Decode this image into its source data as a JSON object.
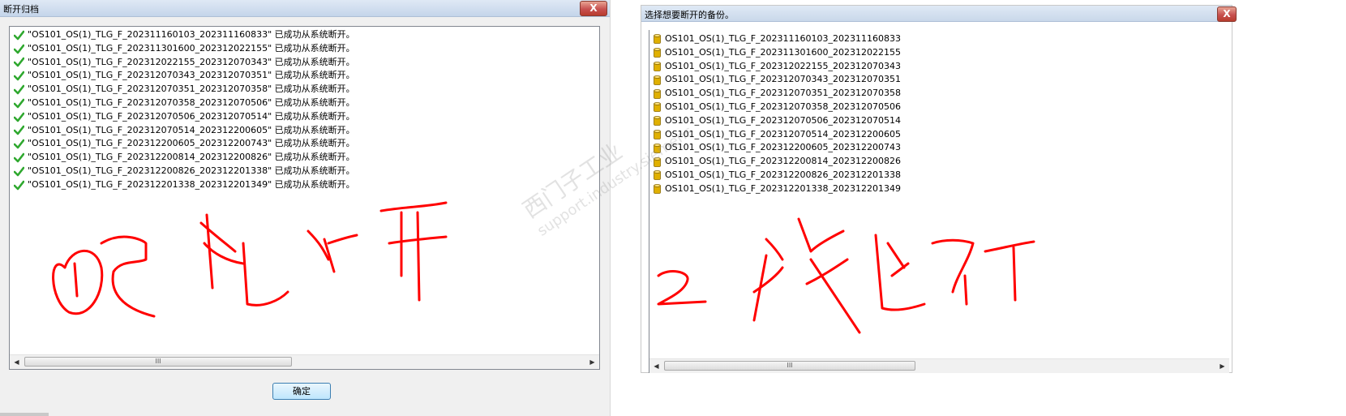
{
  "left_dialog": {
    "title": "断开归档",
    "close_label": "X",
    "ok_label": "确定",
    "scroll_thumb_label": "III",
    "rows": [
      "\"OS101_OS(1)_TLG_F_202311160103_202311160833\" 已成功从系统断开。",
      "\"OS101_OS(1)_TLG_F_202311301600_202312022155\" 已成功从系统断开。",
      "\"OS101_OS(1)_TLG_F_202312022155_202312070343\" 已成功从系统断开。",
      "\"OS101_OS(1)_TLG_F_202312070343_202312070351\" 已成功从系统断开。",
      "\"OS101_OS(1)_TLG_F_202312070351_202312070358\" 已成功从系统断开。",
      "\"OS101_OS(1)_TLG_F_202312070358_202312070506\" 已成功从系统断开。",
      "\"OS101_OS(1)_TLG_F_202312070506_202312070514\" 已成功从系统断开。",
      "\"OS101_OS(1)_TLG_F_202312070514_202312200605\" 已成功从系统断开。",
      "\"OS101_OS(1)_TLG_F_202312200605_202312200743\" 已成功从系统断开。",
      "\"OS101_OS(1)_TLG_F_202312200814_202312200826\" 已成功从系统断开。",
      "\"OS101_OS(1)_TLG_F_202312200826_202312201338\" 已成功从系统断开。",
      "\"OS101_OS(1)_TLG_F_202312201338_202312201349\" 已成功从系统断开。"
    ],
    "row_icon": "green-check-icon"
  },
  "right_panel": {
    "title": "选择想要断开的备份。",
    "close_label": "X",
    "scroll_thumb_label": "III",
    "rows": [
      "OS101_OS(1)_TLG_F_202311160103_202311160833",
      "OS101_OS(1)_TLG_F_202311301600_202312022155",
      "OS101_OS(1)_TLG_F_202312022155_202312070343",
      "OS101_OS(1)_TLG_F_202312070343_202312070351",
      "OS101_OS(1)_TLG_F_202312070351_202312070358",
      "OS101_OS(1)_TLG_F_202312070358_202312070506",
      "OS101_OS(1)_TLG_F_202312070506_202312070514",
      "OS101_OS(1)_TLG_F_202312070514_202312200605",
      "OS101_OS(1)_TLG_F_202312200605_202312200743",
      "OS101_OS(1)_TLG_F_202312200814_202312200826",
      "OS101_OS(1)_TLG_F_202312200826_202312201338",
      "OS101_OS(1)_TLG_F_202312201338_202312201349"
    ],
    "row_icon": "database-icon"
  },
  "watermark": {
    "line1": "西门子工业",
    "line2": "support.industry.siemens"
  },
  "annotations": {
    "left_text": "已断开",
    "right_text": "2 没断开",
    "color": "#ff0000"
  },
  "colors": {
    "check_green": "#2fa82f",
    "db_yellow": "#e0b000",
    "close_red": "#c75050"
  }
}
